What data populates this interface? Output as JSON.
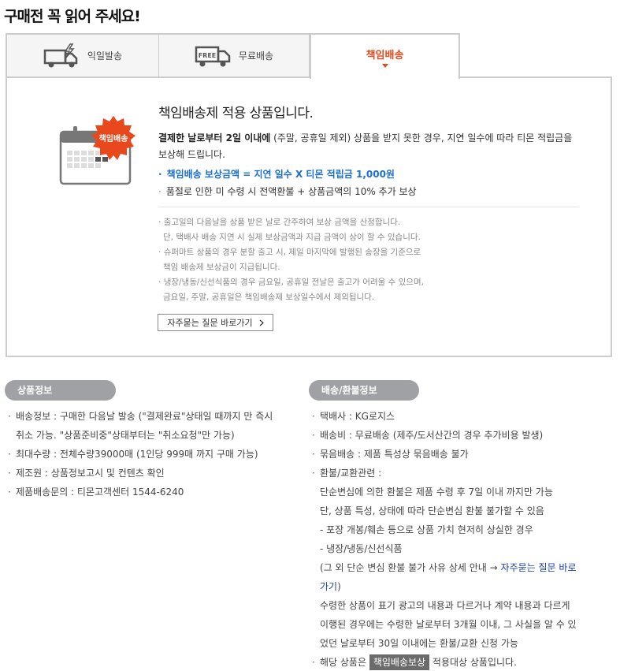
{
  "page": {
    "title": "구매전 꼭 읽어 주세요!"
  },
  "tabs": [
    {
      "label": "익일발송",
      "icon": "express-truck-icon"
    },
    {
      "label": "무료배송",
      "icon": "free-truck-icon",
      "icon_text": "FREE"
    },
    {
      "label": "책임배송",
      "active": true
    }
  ],
  "notice": {
    "badge": "책임배송",
    "title": "책임배송제 적용 상품입니다.",
    "desc_bold": "결제한 날로부터 2일 이내에",
    "desc_rest": " (주말, 공휴일 제외) 상품을 받지 못한 경우, 지연 일수에 따라 티몬 적립금을 보상해 드립니다.",
    "bullet1": "책임배송 보상금액 = 지연 일수 X  티몬 적립금 1,000원",
    "bullet2": "품절로 인한 미 수령 시 전액환불 + 상품금액의 10% 추가 보상",
    "fine_print": [
      "출고일의 다음날을 상품 받은 날로 간주하여 보상 금액을 산정합니다.",
      "단, 택배사 배송 지연 시 실제 보상금액과 지급 금액이 상이 할 수 있습니다.",
      "슈퍼마트 상품의 경우 분할 출고 시, 제일 마지막에 발행된 송장을 기준으로",
      "책임 배송제 보상금이 지급됩니다.",
      "냉장/냉동/신선식품의 경우 금요일, 공휴일 전날은 출고가 어려울 수 있으며,",
      "금요일, 주말, 공휴일은 책임배송제 보상일수에서 제외됩니다."
    ],
    "faq_button": "자주묻는 질문 바로가기",
    "colors": {
      "accent": "#e8481c",
      "link": "#1a6fd2"
    }
  },
  "product_info": {
    "title": "상품정보",
    "items": [
      "배송정보 : 구매한 다음날 발송 (\"결제완료\"상태일 때까지 만 즉시",
      "취소 가능. \"상품준비중\"상태부터는 \"취소요청\"만 가능)",
      "최대수량 : 전체수량39000매 (1인당 999매 까지 구매 가능)",
      "제조원 : 상품정보고시 및 컨텐츠 확인",
      "제품배송문의 : 티몬고객센터 1544-6240"
    ]
  },
  "delivery_info": {
    "title": "배송/환불정보",
    "items": [
      "택배사 : KG로지스",
      "배송비 : 무료배송 (제주/도서산간의 경우 추가비용 발생)",
      "묶음배송 : 제품 특성상 묶음배송 불가",
      "환불/교환관련 :",
      "단순변심에 의한 환불은 제품 수령 후 7일 이내 까지만 가능",
      "단, 상품 특성, 상태에 따라 단순변심 환불 불가할 수 있음",
      "- 포장 개봉/훼손 등으로 상품 가치 현저히 상실한 경우",
      "- 냉장/냉동/신선식품",
      "(그 외 단순 변심 환불 불가 사유 상세 안내 → ",
      "자주묻는 질문 바로",
      "가기",
      ")",
      "수령한 상품이 표기 광고의 내용과 다르거나 계약 내용과 다르게",
      "이행된 경우에는 수령한 날로부터 3개월 이내, 그 사실을 알 수 있",
      "었던 날로부터 30일 이내에는 환불/교환 신청 가능",
      "해당 상품은 ",
      "책임배송보상",
      " 적용대상 상품입니다."
    ]
  }
}
